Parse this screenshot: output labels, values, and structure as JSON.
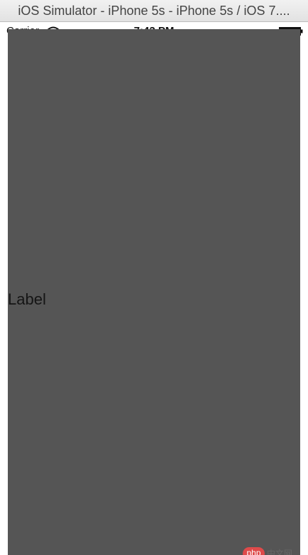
{
  "window": {
    "title": "iOS Simulator - iPhone 5s - iPhone 5s / iOS 7...."
  },
  "status_bar": {
    "carrier": "Carrier",
    "time": "7:43 PM",
    "icons": {
      "wifi": "wifi-icon",
      "battery": "battery-icon"
    }
  },
  "screen": {
    "background_color": "#555555",
    "label": "Label"
  },
  "watermark": {
    "logo_text": "php",
    "text": "中文网"
  }
}
